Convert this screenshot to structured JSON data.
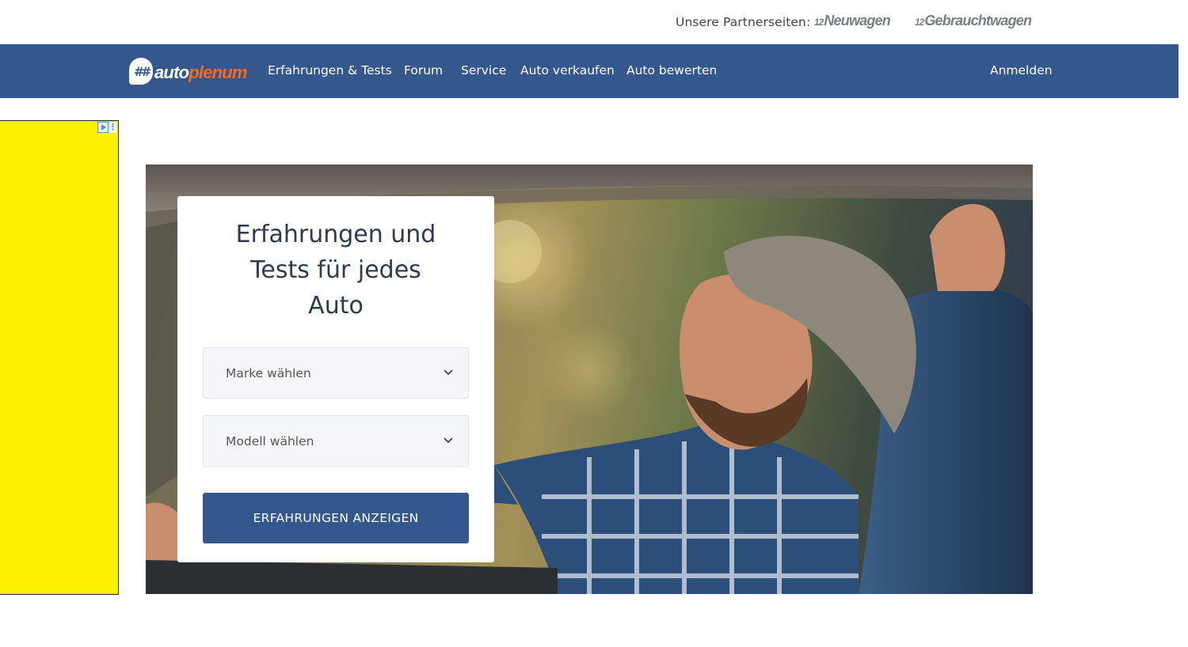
{
  "partners": {
    "label": "Unsere Partnerseiten:",
    "neuwagen_prefix": "12",
    "neuwagen_name": "Neuwagen",
    "gebraucht_prefix": "12",
    "gebraucht_name": "Gebrauchtwagen"
  },
  "brand": {
    "badge": "##",
    "part1": "auto",
    "part2": "plenum",
    "color_primary": "#34588e",
    "color_accent": "#f26a21"
  },
  "nav": {
    "items": [
      {
        "label": "Erfahrungen & Tests"
      },
      {
        "label": "Forum"
      },
      {
        "label": "Service"
      },
      {
        "label": "Auto verkaufen"
      },
      {
        "label": "Auto bewerten"
      }
    ],
    "login": "Anmelden"
  },
  "ad": {
    "background": "#fff200",
    "icons": [
      "adchoices-icon",
      "more-options-icon"
    ]
  },
  "hero": {
    "title_line1": "Erfahrungen und",
    "title_line2": "Tests für jedes",
    "title_line3": "Auto",
    "brand_select": "Marke wählen",
    "model_select": "Modell wählen",
    "submit": "ERFAHRUNGEN ANZEIGEN"
  }
}
